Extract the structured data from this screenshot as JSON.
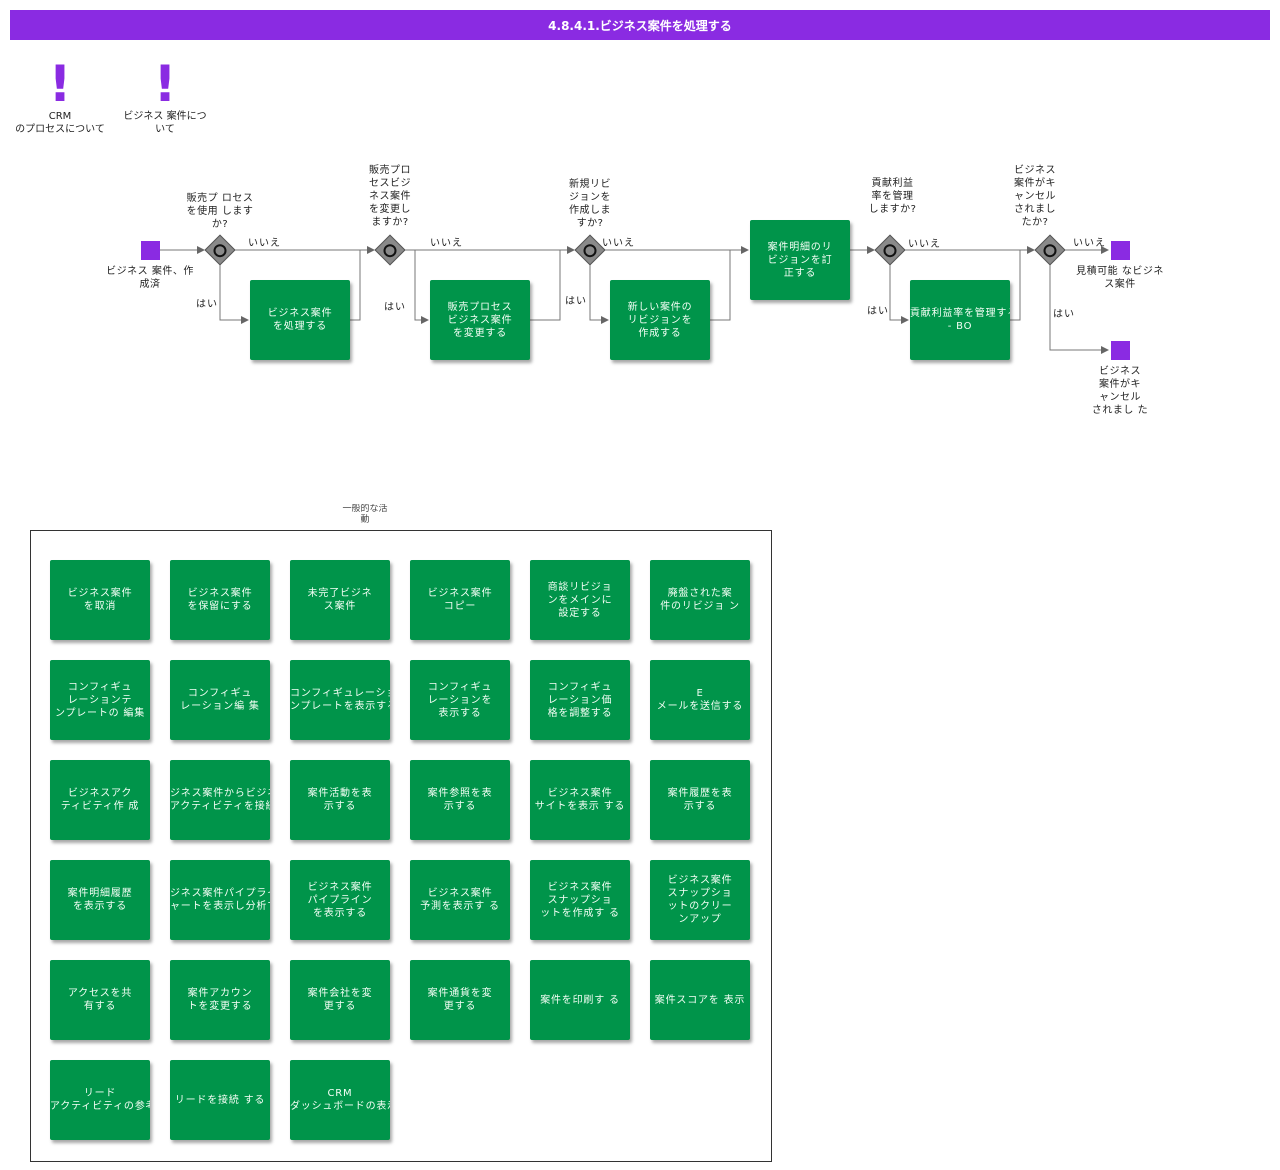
{
  "header": {
    "title": "4.8.4.1.ビジネス案件を処理する"
  },
  "colors": {
    "accent": "#8a2be2",
    "task": "#00944a",
    "gateway": "#8a8a8a"
  },
  "notes": [
    {
      "icon": "exclamation-icon",
      "text": "CRM\nのプロセスについて"
    },
    {
      "icon": "exclamation-icon",
      "text": "ビジネス 案件につ\nいて"
    }
  ],
  "events": {
    "start": "ビジネス 案件、作\n成済",
    "end_quote": "見積可能 なビジネ\nス案件",
    "end_cancel": "ビジネス\n案件がキ\nャンセル\nされまし た"
  },
  "gateways": [
    "販売プ ロセス\nを使用 します\nか?",
    "販売プロ\nセスビジ\nネス案件\nを変更し\nますか?",
    "新規リビ\nジョンを\n作成しま\nすか?",
    "貢献利益\n率を管理\nしますか?",
    "ビジネス\n案件がキ\nャンセル\nされまし\nたか?"
  ],
  "flow_labels": {
    "yes": "はい",
    "no": "いいえ"
  },
  "process_tasks": [
    "ビジネス案件\nを処理する",
    "販売プロセス\nビジネス案件\nを変更する",
    "新しい案件の\nリビジョンを\n作成する",
    "案件明細のリ\nビジョンを訂\n正する",
    "貢献利益率を管理する\n- BO"
  ],
  "general": {
    "title": "一般的な活\n動",
    "tasks": [
      "ビジネス案件\nを取消",
      "ビジネス案件\nを保留にする",
      "未完了ビジネ\nス案件",
      "ビジネス案件\nコピー",
      "商談リビジョ\nンをメインに\n設定する",
      "廃盤された案\n件のリビジョ ン",
      "コンフィギュ\nレーションテ\nンプレートの 編集",
      "コンフィギュ\nレーション編 集",
      "コンフィギュレーショ\nンプレートを表示する",
      "コンフィギュ\nレーションを\n表示する",
      "コンフィギュ\nレーション価\n格を調整する",
      "E\nメールを送信する",
      "ビジネスアク\nティビティ作 成",
      "ジネス案件からビジネ\nアクティビティを接続する",
      "案件活動を表\n示する",
      "案件参照を表\n示する",
      "ビジネス案件\nサイトを表示 する",
      "案件履歴を表\n示する",
      "案件明細履歴\nを表示する",
      "ジネス案件パイプライ\nャートを表示し分析する",
      "ビジネス案件\nパイプライン\nを表示する",
      "ビジネス案件\n予測を表示す る",
      "ビジネス案件\nスナップショ\nットを作成す る",
      "ビジネス案件\nスナップショ\nットのクリー\nンアップ",
      "アクセスを共\n有する",
      "案件アカウン\nトを変更する",
      "案件会社を変\n更する",
      "案件通貨を変\n更する",
      "案件を印刷す る",
      "案件スコアを 表示",
      "リード\nアクティビティの参考を表",
      "リードを接続 する",
      "CRM\nダッシュボードの表示"
    ]
  }
}
